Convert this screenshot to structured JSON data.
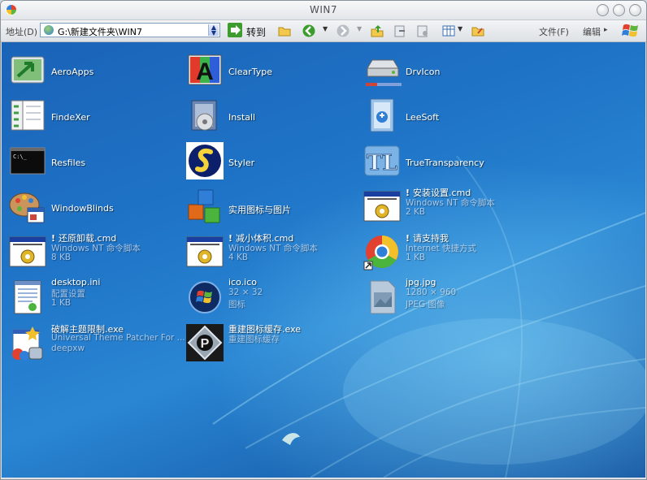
{
  "window": {
    "title": "WIN7"
  },
  "toolbar": {
    "address_label": "地址(D)",
    "address_value": "G:\\新建文件夹\\WIN7",
    "go_label": "转到",
    "menu_file": "文件(F)",
    "menu_edit": "编辑",
    "menu_more": "▸"
  },
  "items": [
    {
      "name": "AeroApps",
      "icon": "aeroapps-icon"
    },
    {
      "name": "ClearType",
      "icon": "cleartype-icon"
    },
    {
      "name": "DrvIcon",
      "icon": "drive-icon"
    },
    {
      "name": "FindeXer",
      "icon": "findexer-icon"
    },
    {
      "name": "Install",
      "icon": "install-icon"
    },
    {
      "name": "LeeSoft",
      "icon": "leesoft-icon"
    },
    {
      "name": "Resfiles",
      "icon": "console-icon"
    },
    {
      "name": "Styler",
      "icon": "styler-icon"
    },
    {
      "name": "TrueTransparency",
      "icon": "truetransparency-icon"
    },
    {
      "name": "WindowBlinds",
      "icon": "windowblinds-icon"
    },
    {
      "name": "实用图标与图片",
      "icon": "cubes-icon"
    },
    {
      "name": "安装设置.cmd",
      "sub1": "Windows NT 命令脚本",
      "sub2": "2 KB",
      "icon": "cmd-script-icon",
      "bang": "!"
    },
    {
      "name": "还原卸载.cmd",
      "sub1": "Windows NT 命令脚本",
      "sub2": "8 KB",
      "icon": "cmd-script-icon",
      "bang": "!"
    },
    {
      "name": "减小体积.cmd",
      "sub1": "Windows NT 命令脚本",
      "sub2": "4 KB",
      "icon": "cmd-script-icon",
      "bang": "!"
    },
    {
      "name": "请支持我",
      "sub1": "Internet 快捷方式",
      "sub2": "1 KB",
      "icon": "chrome-shortcut-icon",
      "bang": "!"
    },
    {
      "name": "desktop.ini",
      "sub1": "配置设置",
      "sub2": "1 KB",
      "icon": "notepad-icon"
    },
    {
      "name": "ico.ico",
      "sub1": "32 × 32",
      "sub2": "图标",
      "icon": "windows-orb-icon"
    },
    {
      "name": "jpg.jpg",
      "sub1": "1280 × 960",
      "sub2": "JPEG 图像",
      "icon": "jpeg-file-icon"
    },
    {
      "name": "破解主题限制.exe",
      "sub1": "Universal Theme Patcher For ...",
      "sub2": "deepxw",
      "icon": "theme-patcher-icon"
    },
    {
      "name": "重建图标缓存.exe",
      "sub1": "重建图标缓存",
      "icon": "rebuild-cache-icon"
    }
  ]
}
